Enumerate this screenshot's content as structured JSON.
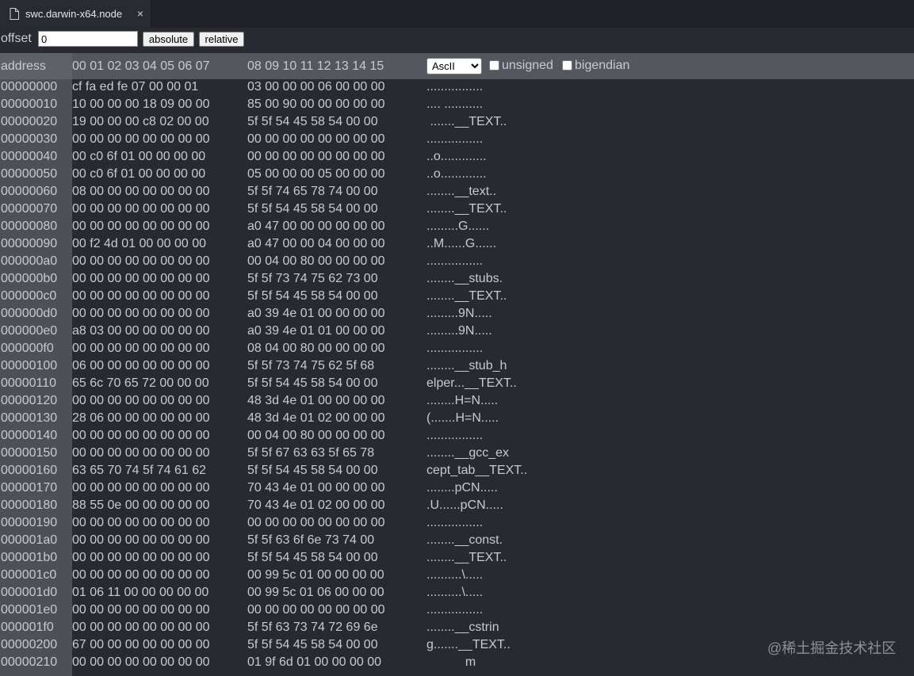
{
  "tab": {
    "title": "swc.darwin-x64.node",
    "close_glyph": "×",
    "icon": "file-icon"
  },
  "toolbar": {
    "offset_label": "offset",
    "offset_value": "0",
    "absolute_label": "absolute",
    "relative_label": "relative"
  },
  "header": {
    "address_label": "address",
    "cols1": "00 01 02 03 04 05 06 07",
    "cols2": "08 09 10 11 12 13 14 15",
    "encoding_selected": "AscII",
    "unsigned_label": "unsigned",
    "bigendian_label": "bigendian"
  },
  "rows": [
    {
      "addr": "00000000",
      "h1": "cf fa ed fe 07 00 00 01",
      "h2": "03 00 00 00 06 00 00 00",
      "ascii": "................"
    },
    {
      "addr": "00000010",
      "h1": "10 00 00 00 18 09 00 00",
      "h2": "85 00 90 00 00 00 00 00",
      "ascii": ".... ..........."
    },
    {
      "addr": "00000020",
      "h1": "19 00 00 00 c8 02 00 00",
      "h2": "5f 5f 54 45 58 54 00 00",
      "ascii": " .......__TEXT.."
    },
    {
      "addr": "00000030",
      "h1": "00 00 00 00 00 00 00 00",
      "h2": "00 00 00 00 00 00 00 00",
      "ascii": "................"
    },
    {
      "addr": "00000040",
      "h1": "00 c0 6f 01 00 00 00 00",
      "h2": "00 00 00 00 00 00 00 00",
      "ascii": "..o............."
    },
    {
      "addr": "00000050",
      "h1": "00 c0 6f 01 00 00 00 00",
      "h2": "05 00 00 00 05 00 00 00",
      "ascii": "..o............."
    },
    {
      "addr": "00000060",
      "h1": "08 00 00 00 00 00 00 00",
      "h2": "5f 5f 74 65 78 74 00 00",
      "ascii": "........__text.."
    },
    {
      "addr": "00000070",
      "h1": "00 00 00 00 00 00 00 00",
      "h2": "5f 5f 54 45 58 54 00 00",
      "ascii": "........__TEXT.."
    },
    {
      "addr": "00000080",
      "h1": "00 00 00 00 00 00 00 00",
      "h2": "a0 47 00 00 00 00 00 00",
      "ascii": ".........G......"
    },
    {
      "addr": "00000090",
      "h1": "00 f2 4d 01 00 00 00 00",
      "h2": "a0 47 00 00 04 00 00 00",
      "ascii": "..M......G......"
    },
    {
      "addr": "000000a0",
      "h1": "00 00 00 00 00 00 00 00",
      "h2": "00 04 00 80 00 00 00 00",
      "ascii": "................"
    },
    {
      "addr": "000000b0",
      "h1": "00 00 00 00 00 00 00 00",
      "h2": "5f 5f 73 74 75 62 73 00",
      "ascii": "........__stubs."
    },
    {
      "addr": "000000c0",
      "h1": "00 00 00 00 00 00 00 00",
      "h2": "5f 5f 54 45 58 54 00 00",
      "ascii": "........__TEXT.."
    },
    {
      "addr": "000000d0",
      "h1": "00 00 00 00 00 00 00 00",
      "h2": "a0 39 4e 01 00 00 00 00",
      "ascii": ".........9N....."
    },
    {
      "addr": "000000e0",
      "h1": "a8 03 00 00 00 00 00 00",
      "h2": "a0 39 4e 01 01 00 00 00",
      "ascii": ".........9N....."
    },
    {
      "addr": "000000f0",
      "h1": "00 00 00 00 00 00 00 00",
      "h2": "08 04 00 80 00 00 00 00",
      "ascii": "................"
    },
    {
      "addr": "00000100",
      "h1": "06 00 00 00 00 00 00 00",
      "h2": "5f 5f 73 74 75 62 5f 68",
      "ascii": "........__stub_h"
    },
    {
      "addr": "00000110",
      "h1": "65 6c 70 65 72 00 00 00",
      "h2": "5f 5f 54 45 58 54 00 00",
      "ascii": "elper...__TEXT.."
    },
    {
      "addr": "00000120",
      "h1": "00 00 00 00 00 00 00 00",
      "h2": "48 3d 4e 01 00 00 00 00",
      "ascii": "........H=N....."
    },
    {
      "addr": "00000130",
      "h1": "28 06 00 00 00 00 00 00",
      "h2": "48 3d 4e 01 02 00 00 00",
      "ascii": "(.......H=N....."
    },
    {
      "addr": "00000140",
      "h1": "00 00 00 00 00 00 00 00",
      "h2": "00 04 00 80 00 00 00 00",
      "ascii": "................"
    },
    {
      "addr": "00000150",
      "h1": "00 00 00 00 00 00 00 00",
      "h2": "5f 5f 67 63 63 5f 65 78",
      "ascii": "........__gcc_ex"
    },
    {
      "addr": "00000160",
      "h1": "63 65 70 74 5f 74 61 62",
      "h2": "5f 5f 54 45 58 54 00 00",
      "ascii": "cept_tab__TEXT.."
    },
    {
      "addr": "00000170",
      "h1": "00 00 00 00 00 00 00 00",
      "h2": "70 43 4e 01 00 00 00 00",
      "ascii": "........pCN....."
    },
    {
      "addr": "00000180",
      "h1": "88 55 0e 00 00 00 00 00",
      "h2": "70 43 4e 01 02 00 00 00",
      "ascii": ".U......pCN....."
    },
    {
      "addr": "00000190",
      "h1": "00 00 00 00 00 00 00 00",
      "h2": "00 00 00 00 00 00 00 00",
      "ascii": "................"
    },
    {
      "addr": "000001a0",
      "h1": "00 00 00 00 00 00 00 00",
      "h2": "5f 5f 63 6f 6e 73 74 00",
      "ascii": "........__const."
    },
    {
      "addr": "000001b0",
      "h1": "00 00 00 00 00 00 00 00",
      "h2": "5f 5f 54 45 58 54 00 00",
      "ascii": "........__TEXT.."
    },
    {
      "addr": "000001c0",
      "h1": "00 00 00 00 00 00 00 00",
      "h2": "00 99 5c 01 00 00 00 00",
      "ascii": "..........\\....."
    },
    {
      "addr": "000001d0",
      "h1": "01 06 11 00 00 00 00 00",
      "h2": "00 99 5c 01 06 00 00 00",
      "ascii": "..........\\....."
    },
    {
      "addr": "000001e0",
      "h1": "00 00 00 00 00 00 00 00",
      "h2": "00 00 00 00 00 00 00 00",
      "ascii": "................"
    },
    {
      "addr": "000001f0",
      "h1": "00 00 00 00 00 00 00 00",
      "h2": "5f 5f 63 73 74 72 69 6e",
      "ascii": "........__cstrin"
    },
    {
      "addr": "00000200",
      "h1": "67 00 00 00 00 00 00 00",
      "h2": "5f 5f 54 45 58 54 00 00",
      "ascii": "g.......__TEXT.."
    },
    {
      "addr": "00000210",
      "h1": "00 00 00 00 00 00 00 00",
      "h2": "01 9f 6d 01 00 00 00 00",
      "ascii": "           m    "
    }
  ],
  "watermark": "@稀土掘金技术社区"
}
